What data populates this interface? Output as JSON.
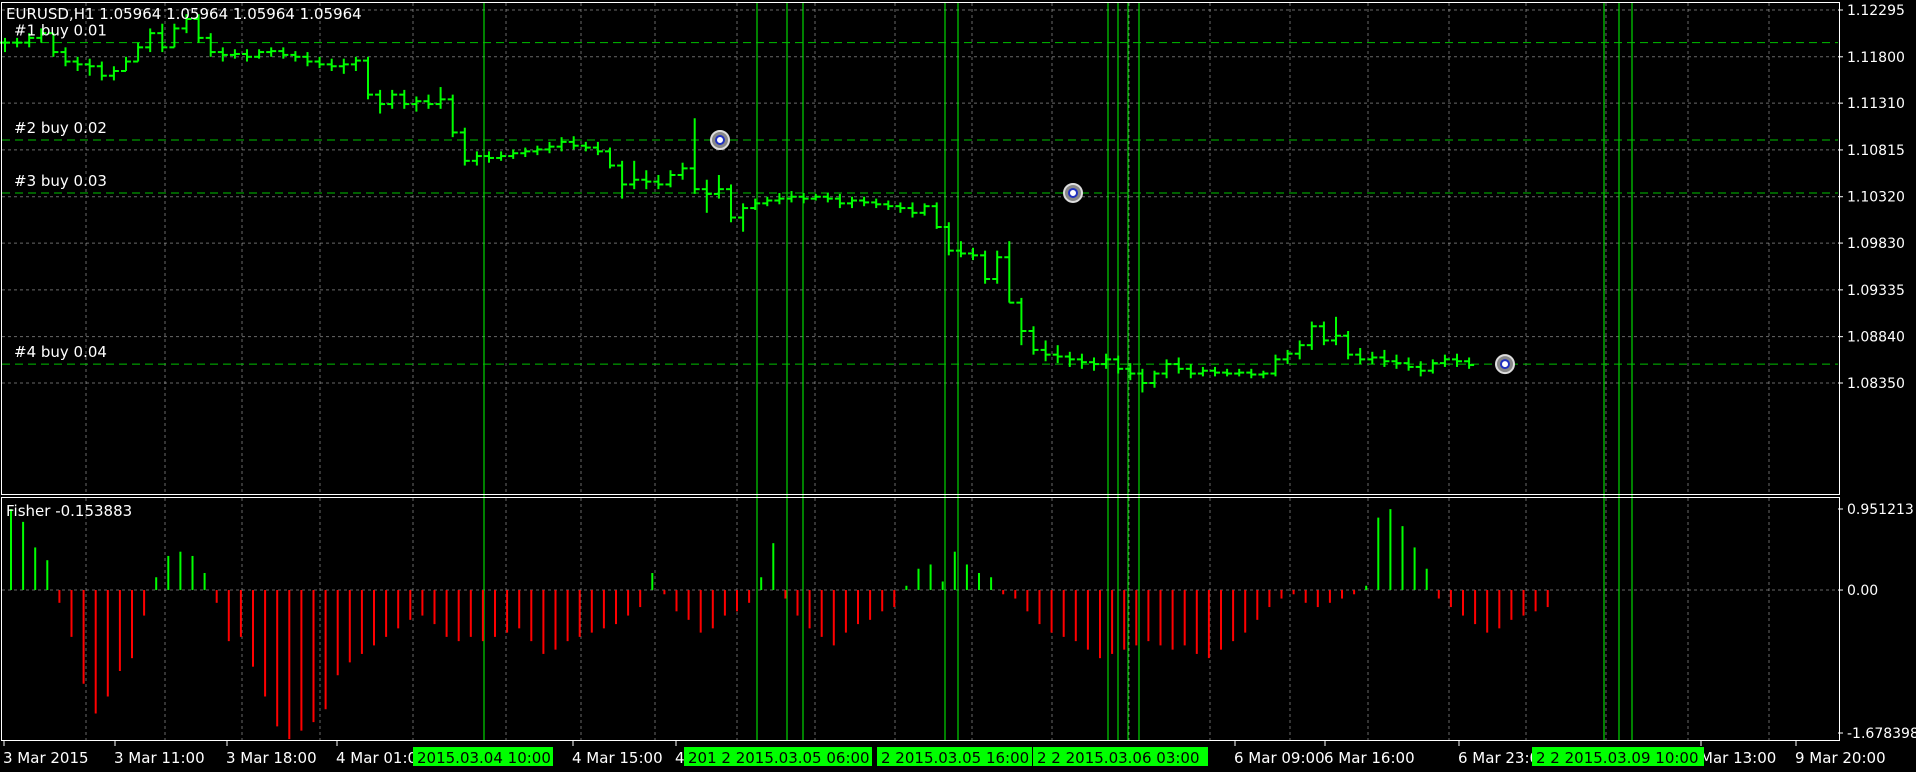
{
  "chart_title": "EURUSD,H1  1.05964 1.05964 1.05964 1.05964",
  "indicator_title": "Fisher -0.153883",
  "price_axis": [
    "1.12295",
    "1.11800",
    "1.11310",
    "1.10815",
    "1.10320",
    "1.09830",
    "1.09335",
    "1.08840",
    "1.08350"
  ],
  "indicator_axis": [
    "0.951213",
    "0.00",
    "-1.678398"
  ],
  "time_axis": [
    "3 Mar 2015",
    "3 Mar 11:00",
    "3 Mar 18:00",
    "4 Mar 01:0",
    "4 Mar 15:00",
    "4",
    "6 Mar 09:00",
    "6 Mar 16:00",
    "6 Mar 23:0",
    "Mar 13:00",
    "9 Mar 20:00"
  ],
  "time_markers": [
    "2015.03.04 10:00",
    "201 2 2015.03.05 06:00",
    "2 2015.03.05 16:00",
    "2 2 2015.03.06 03:00",
    "2 2 2015.03.09 10:00"
  ],
  "orders": [
    "#1 buy 0.01",
    "#2 buy 0.02",
    "#3 buy 0.03",
    "#4 buy 0.04"
  ],
  "colors": {
    "background": "#000000",
    "grid": "#c0c0c0",
    "candle": "#00ff00",
    "level": "#00c000",
    "fisher_pos": "#00ff00",
    "fisher_neg": "#ff0000",
    "label_bg": "#00ff00"
  },
  "chart_data": {
    "type": "bar",
    "symbol": "EURUSD",
    "timeframe": "H1",
    "price_scale": {
      "max": 1.12295,
      "min": 1.0835
    },
    "order_levels": [
      1.1195,
      1.1092,
      1.1036,
      1.0855
    ],
    "entry_markers": [
      {
        "bar": 32,
        "price": 1.1092
      },
      {
        "bar": 48,
        "price": 1.1036
      },
      {
        "bar": 67,
        "price": 1.0855
      }
    ],
    "ohlc": [
      [
        1.1195,
        1.12,
        1.1185,
        1.1195
      ],
      [
        1.1195,
        1.12,
        1.119,
        1.1195
      ],
      [
        1.1195,
        1.1205,
        1.119,
        1.12
      ],
      [
        1.12,
        1.121,
        1.1195,
        1.1205
      ],
      [
        1.1205,
        1.1205,
        1.118,
        1.1185
      ],
      [
        1.1185,
        1.119,
        1.117,
        1.1175
      ],
      [
        1.1175,
        1.118,
        1.1165,
        1.1172
      ],
      [
        1.1172,
        1.1178,
        1.116,
        1.117
      ],
      [
        1.117,
        1.1175,
        1.1155,
        1.116
      ],
      [
        1.116,
        1.117,
        1.1155,
        1.1165
      ],
      [
        1.1165,
        1.118,
        1.1165,
        1.1175
      ],
      [
        1.1175,
        1.1195,
        1.1175,
        1.119
      ],
      [
        1.119,
        1.121,
        1.1185,
        1.1205
      ],
      [
        1.1205,
        1.1215,
        1.1185,
        1.119
      ],
      [
        1.119,
        1.1215,
        1.119,
        1.121
      ],
      [
        1.121,
        1.1225,
        1.1205,
        1.122
      ],
      [
        1.122,
        1.1225,
        1.1195,
        1.12
      ],
      [
        1.12,
        1.1205,
        1.118,
        1.1185
      ],
      [
        1.1185,
        1.119,
        1.1175,
        1.1182
      ],
      [
        1.1182,
        1.1188,
        1.1178,
        1.1183
      ],
      [
        1.1183,
        1.1188,
        1.1175,
        1.118
      ],
      [
        1.118,
        1.1188,
        1.1178,
        1.1185
      ],
      [
        1.1185,
        1.119,
        1.118,
        1.1186
      ],
      [
        1.1186,
        1.119,
        1.1178,
        1.1182
      ],
      [
        1.1182,
        1.1186,
        1.1175,
        1.118
      ],
      [
        1.118,
        1.1185,
        1.117,
        1.1175
      ],
      [
        1.1175,
        1.118,
        1.1168,
        1.1172
      ],
      [
        1.1172,
        1.1178,
        1.1165,
        1.117
      ],
      [
        1.117,
        1.1178,
        1.1162,
        1.1172
      ],
      [
        1.1172,
        1.118,
        1.1165,
        1.1176
      ],
      [
        1.1176,
        1.118,
        1.1135,
        1.114
      ],
      [
        1.114,
        1.1145,
        1.112,
        1.113
      ],
      [
        1.113,
        1.1145,
        1.1125,
        1.114
      ],
      [
        1.114,
        1.1145,
        1.1125,
        1.113
      ],
      [
        1.113,
        1.1138,
        1.1122,
        1.1133
      ],
      [
        1.1133,
        1.114,
        1.1125,
        1.113
      ],
      [
        1.113,
        1.1148,
        1.1125,
        1.1135
      ],
      [
        1.1135,
        1.114,
        1.1095,
        1.11
      ],
      [
        1.11,
        1.1105,
        1.1065,
        1.107
      ],
      [
        1.107,
        1.108,
        1.1065,
        1.1075
      ],
      [
        1.1075,
        1.108,
        1.1068,
        1.1073
      ],
      [
        1.1073,
        1.108,
        1.107,
        1.1075
      ],
      [
        1.1075,
        1.1082,
        1.1072,
        1.1078
      ],
      [
        1.1078,
        1.1084,
        1.1074,
        1.108
      ],
      [
        1.108,
        1.1086,
        1.1076,
        1.1082
      ],
      [
        1.1082,
        1.109,
        1.1078,
        1.1085
      ],
      [
        1.1085,
        1.1095,
        1.108,
        1.109
      ],
      [
        1.109,
        1.1096,
        1.1082,
        1.1086
      ],
      [
        1.1086,
        1.109,
        1.108,
        1.1084
      ],
      [
        1.1084,
        1.109,
        1.1076,
        1.108
      ],
      [
        1.108,
        1.1084,
        1.1062,
        1.1065
      ],
      [
        1.1065,
        1.107,
        1.103,
        1.1045
      ],
      [
        1.1045,
        1.107,
        1.104,
        1.105
      ],
      [
        1.105,
        1.106,
        1.104,
        1.1048
      ],
      [
        1.1048,
        1.1055,
        1.104,
        1.1045
      ],
      [
        1.1045,
        1.106,
        1.1042,
        1.1055
      ],
      [
        1.1055,
        1.1068,
        1.105,
        1.1062
      ],
      [
        1.1062,
        1.1115,
        1.1035,
        1.104
      ],
      [
        1.104,
        1.105,
        1.1015,
        1.1035
      ],
      [
        1.1035,
        1.1055,
        1.103,
        1.104
      ],
      [
        1.104,
        1.1045,
        1.1005,
        1.101
      ],
      [
        1.101,
        1.1025,
        1.0995,
        1.102
      ],
      [
        1.102,
        1.103,
        1.1018,
        1.1025
      ],
      [
        1.1025,
        1.1032,
        1.1022,
        1.1028
      ],
      [
        1.1028,
        1.1036,
        1.1024,
        1.103
      ],
      [
        1.103,
        1.1038,
        1.1026,
        1.1032
      ],
      [
        1.1032,
        1.1036,
        1.1025,
        1.103
      ],
      [
        1.103,
        1.1035,
        1.1028,
        1.1032
      ],
      [
        1.1032,
        1.1036,
        1.1026,
        1.103
      ],
      [
        1.103,
        1.1035,
        1.102,
        1.1025
      ],
      [
        1.1025,
        1.1032,
        1.102,
        1.1028
      ],
      [
        1.1028,
        1.1032,
        1.1022,
        1.1026
      ],
      [
        1.1026,
        1.103,
        1.102,
        1.1024
      ],
      [
        1.1024,
        1.1028,
        1.1018,
        1.1022
      ],
      [
        1.1022,
        1.1026,
        1.1015,
        1.102
      ],
      [
        1.102,
        1.1026,
        1.101,
        1.1015
      ],
      [
        1.1015,
        1.1025,
        1.1012,
        1.1022
      ],
      [
        1.1022,
        1.1026,
        1.0998,
        1.1
      ],
      [
        1.1,
        1.1005,
        1.097,
        1.0975
      ],
      [
        1.0975,
        1.0985,
        1.0968,
        1.0972
      ],
      [
        1.0972,
        1.0978,
        1.0965,
        1.097
      ],
      [
        1.097,
        1.0975,
        1.094,
        1.0945
      ],
      [
        1.0945,
        1.0975,
        1.094,
        1.0968
      ],
      [
        1.0968,
        1.0985,
        1.092,
        1.092
      ],
      [
        1.092,
        1.0925,
        1.0875,
        1.089
      ],
      [
        1.089,
        1.0895,
        1.0865,
        1.087
      ],
      [
        1.087,
        1.088,
        1.0858,
        1.0865
      ],
      [
        1.0865,
        1.0875,
        1.0856,
        1.0863
      ],
      [
        1.0863,
        1.0868,
        1.0852,
        1.086
      ],
      [
        1.086,
        1.0866,
        1.085,
        1.0857
      ],
      [
        1.0857,
        1.0862,
        1.0848,
        1.0855
      ],
      [
        1.0855,
        1.0866,
        1.085,
        1.086
      ],
      [
        1.086,
        1.0864,
        1.0845,
        1.085
      ],
      [
        1.085,
        1.0856,
        1.0838,
        1.0845
      ],
      [
        1.0845,
        1.085,
        1.0825,
        1.0835
      ],
      [
        1.0835,
        1.0848,
        1.083,
        1.0845
      ],
      [
        1.0845,
        1.086,
        1.084,
        1.0855
      ],
      [
        1.0855,
        1.0862,
        1.0845,
        1.085
      ],
      [
        1.085,
        1.0855,
        1.084,
        1.0845
      ],
      [
        1.0845,
        1.0852,
        1.0842,
        1.0848
      ],
      [
        1.0848,
        1.0852,
        1.0842,
        1.0846
      ],
      [
        1.0846,
        1.085,
        1.0842,
        1.0845
      ],
      [
        1.0845,
        1.085,
        1.0842,
        1.0846
      ],
      [
        1.0846,
        1.085,
        1.084,
        1.0844
      ],
      [
        1.0844,
        1.0848,
        1.084,
        1.0845
      ],
      [
        1.0845,
        1.0865,
        1.0842,
        1.086
      ],
      [
        1.086,
        1.087,
        1.0855,
        1.0866
      ],
      [
        1.0866,
        1.088,
        1.086,
        1.0875
      ],
      [
        1.0875,
        1.09,
        1.087,
        1.0895
      ],
      [
        1.0895,
        1.09,
        1.0875,
        1.088
      ],
      [
        1.088,
        1.0905,
        1.0875,
        1.0885
      ],
      [
        1.0885,
        1.089,
        1.086,
        1.0865
      ],
      [
        1.0865,
        1.0872,
        1.0855,
        1.086
      ],
      [
        1.086,
        1.0868,
        1.0855,
        1.0862
      ],
      [
        1.0862,
        1.087,
        1.0852,
        1.0858
      ],
      [
        1.0858,
        1.0865,
        1.085,
        1.0856
      ],
      [
        1.0856,
        1.0862,
        1.0848,
        1.0852
      ],
      [
        1.0852,
        1.0858,
        1.0842,
        1.0848
      ],
      [
        1.0848,
        1.086,
        1.0845,
        1.0856
      ],
      [
        1.0856,
        1.0865,
        1.0852,
        1.086
      ],
      [
        1.086,
        1.0866,
        1.0852,
        1.0858
      ],
      [
        1.0858,
        1.0862,
        1.085,
        1.0854
      ]
    ],
    "fisher": [
      0.95,
      0.8,
      0.5,
      0.35,
      -0.15,
      -0.55,
      -1.1,
      -1.45,
      -1.25,
      -0.95,
      -0.8,
      -0.3,
      0.15,
      0.4,
      0.45,
      0.4,
      0.2,
      -0.15,
      -0.6,
      -0.55,
      -0.9,
      -1.25,
      -1.6,
      -1.75,
      -1.65,
      -1.55,
      -1.4,
      -1.0,
      -0.85,
      -0.75,
      -0.65,
      -0.55,
      -0.45,
      -0.35,
      -0.3,
      -0.4,
      -0.55,
      -0.6,
      -0.55,
      -0.6,
      -0.55,
      -0.5,
      -0.45,
      -0.6,
      -0.75,
      -0.7,
      -0.6,
      -0.55,
      -0.5,
      -0.45,
      -0.4,
      -0.3,
      -0.2,
      0.2,
      -0.05,
      -0.25,
      -0.35,
      -0.5,
      -0.45,
      -0.3,
      -0.25,
      -0.15,
      0.15,
      0.55,
      -0.1,
      -0.3,
      -0.45,
      -0.55,
      -0.65,
      -0.5,
      -0.4,
      -0.35,
      -0.25,
      -0.2,
      0.05,
      0.25,
      0.3,
      0.1,
      0.45,
      0.3,
      0.2,
      0.15,
      -0.05,
      -0.1,
      -0.25,
      -0.4,
      -0.5,
      -0.55,
      -0.6,
      -0.7,
      -0.8,
      -0.75,
      -0.7,
      -0.65,
      -0.6,
      -0.65,
      -0.7,
      -0.65,
      -0.75,
      -0.8,
      -0.7,
      -0.6,
      -0.5,
      -0.35,
      -0.2,
      -0.1,
      -0.05,
      -0.15,
      -0.2,
      -0.15,
      -0.1,
      -0.05,
      0.05,
      0.85,
      0.95,
      0.75,
      0.5,
      0.25,
      -0.1,
      -0.2,
      -0.3,
      -0.4,
      -0.5,
      -0.45,
      -0.35,
      -0.3,
      -0.25,
      -0.2
    ]
  }
}
